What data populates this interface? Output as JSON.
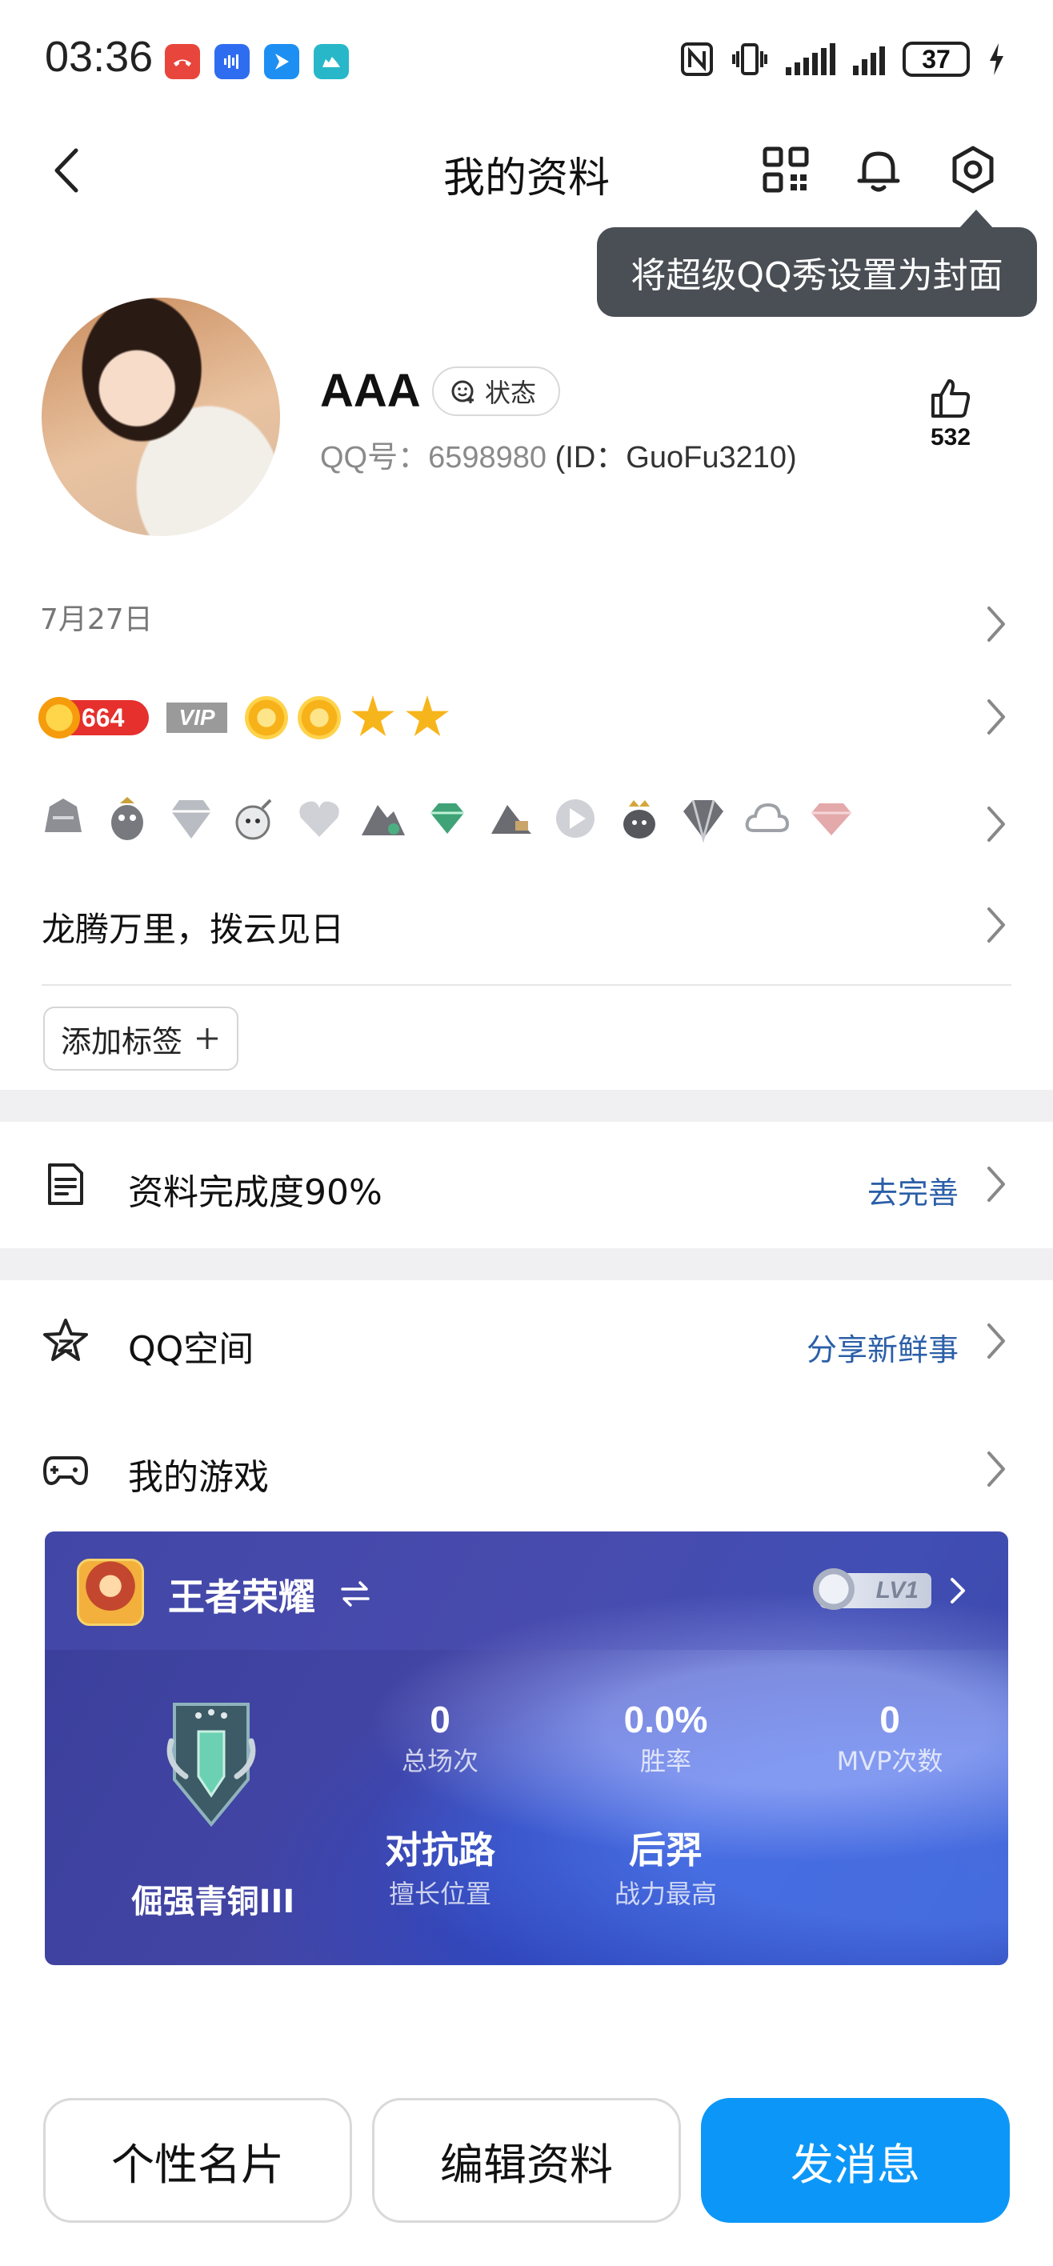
{
  "status_bar": {
    "time": "03:36",
    "battery": "37",
    "app_icons": [
      "missed-call-icon",
      "voice-memo-icon",
      "arrow-app-icon",
      "camel-app-icon"
    ],
    "indicators": [
      "nfc-icon",
      "vibrate-icon",
      "signal-icon",
      "signal-icon",
      "battery-icon",
      "charging-icon"
    ]
  },
  "header": {
    "title": "我的资料",
    "tooltip": "将超级QQ秀设置为封面"
  },
  "profile": {
    "nickname": "AAA",
    "status_label": "状态",
    "qq_label": "QQ号：",
    "qq_number": "6598980",
    "id_text": "(ID：GuoFu3210)",
    "likes": "532"
  },
  "birthday": "7月27日",
  "vip": {
    "level": "664",
    "vip_tag": "VIP"
  },
  "signature": "龙腾万里，拨云见日",
  "add_tag_label": "添加标签",
  "completion": {
    "label": "资料完成度90%",
    "action": "去完善"
  },
  "qzone": {
    "label": "QQ空间",
    "action": "分享新鲜事"
  },
  "games": {
    "label": "我的游戏",
    "card": {
      "game_name": "王者荣耀",
      "level": "LV1",
      "rank": "倔强青铜III",
      "stats": [
        {
          "value": "0",
          "caption": "总场次"
        },
        {
          "value": "0.0%",
          "caption": "胜率"
        },
        {
          "value": "0",
          "caption": "MVP次数"
        },
        {
          "value": "对抗路",
          "caption": "擅长位置"
        },
        {
          "value": "后羿",
          "caption": "战力最高"
        }
      ]
    }
  },
  "buttons": {
    "card": "个性名片",
    "edit": "编辑资料",
    "message": "发消息"
  },
  "colors": {
    "primary": "#0c97f8",
    "link": "#2b5fa8",
    "tooltip_bg": "#4a4f55",
    "level_badge": "#e5302d"
  }
}
